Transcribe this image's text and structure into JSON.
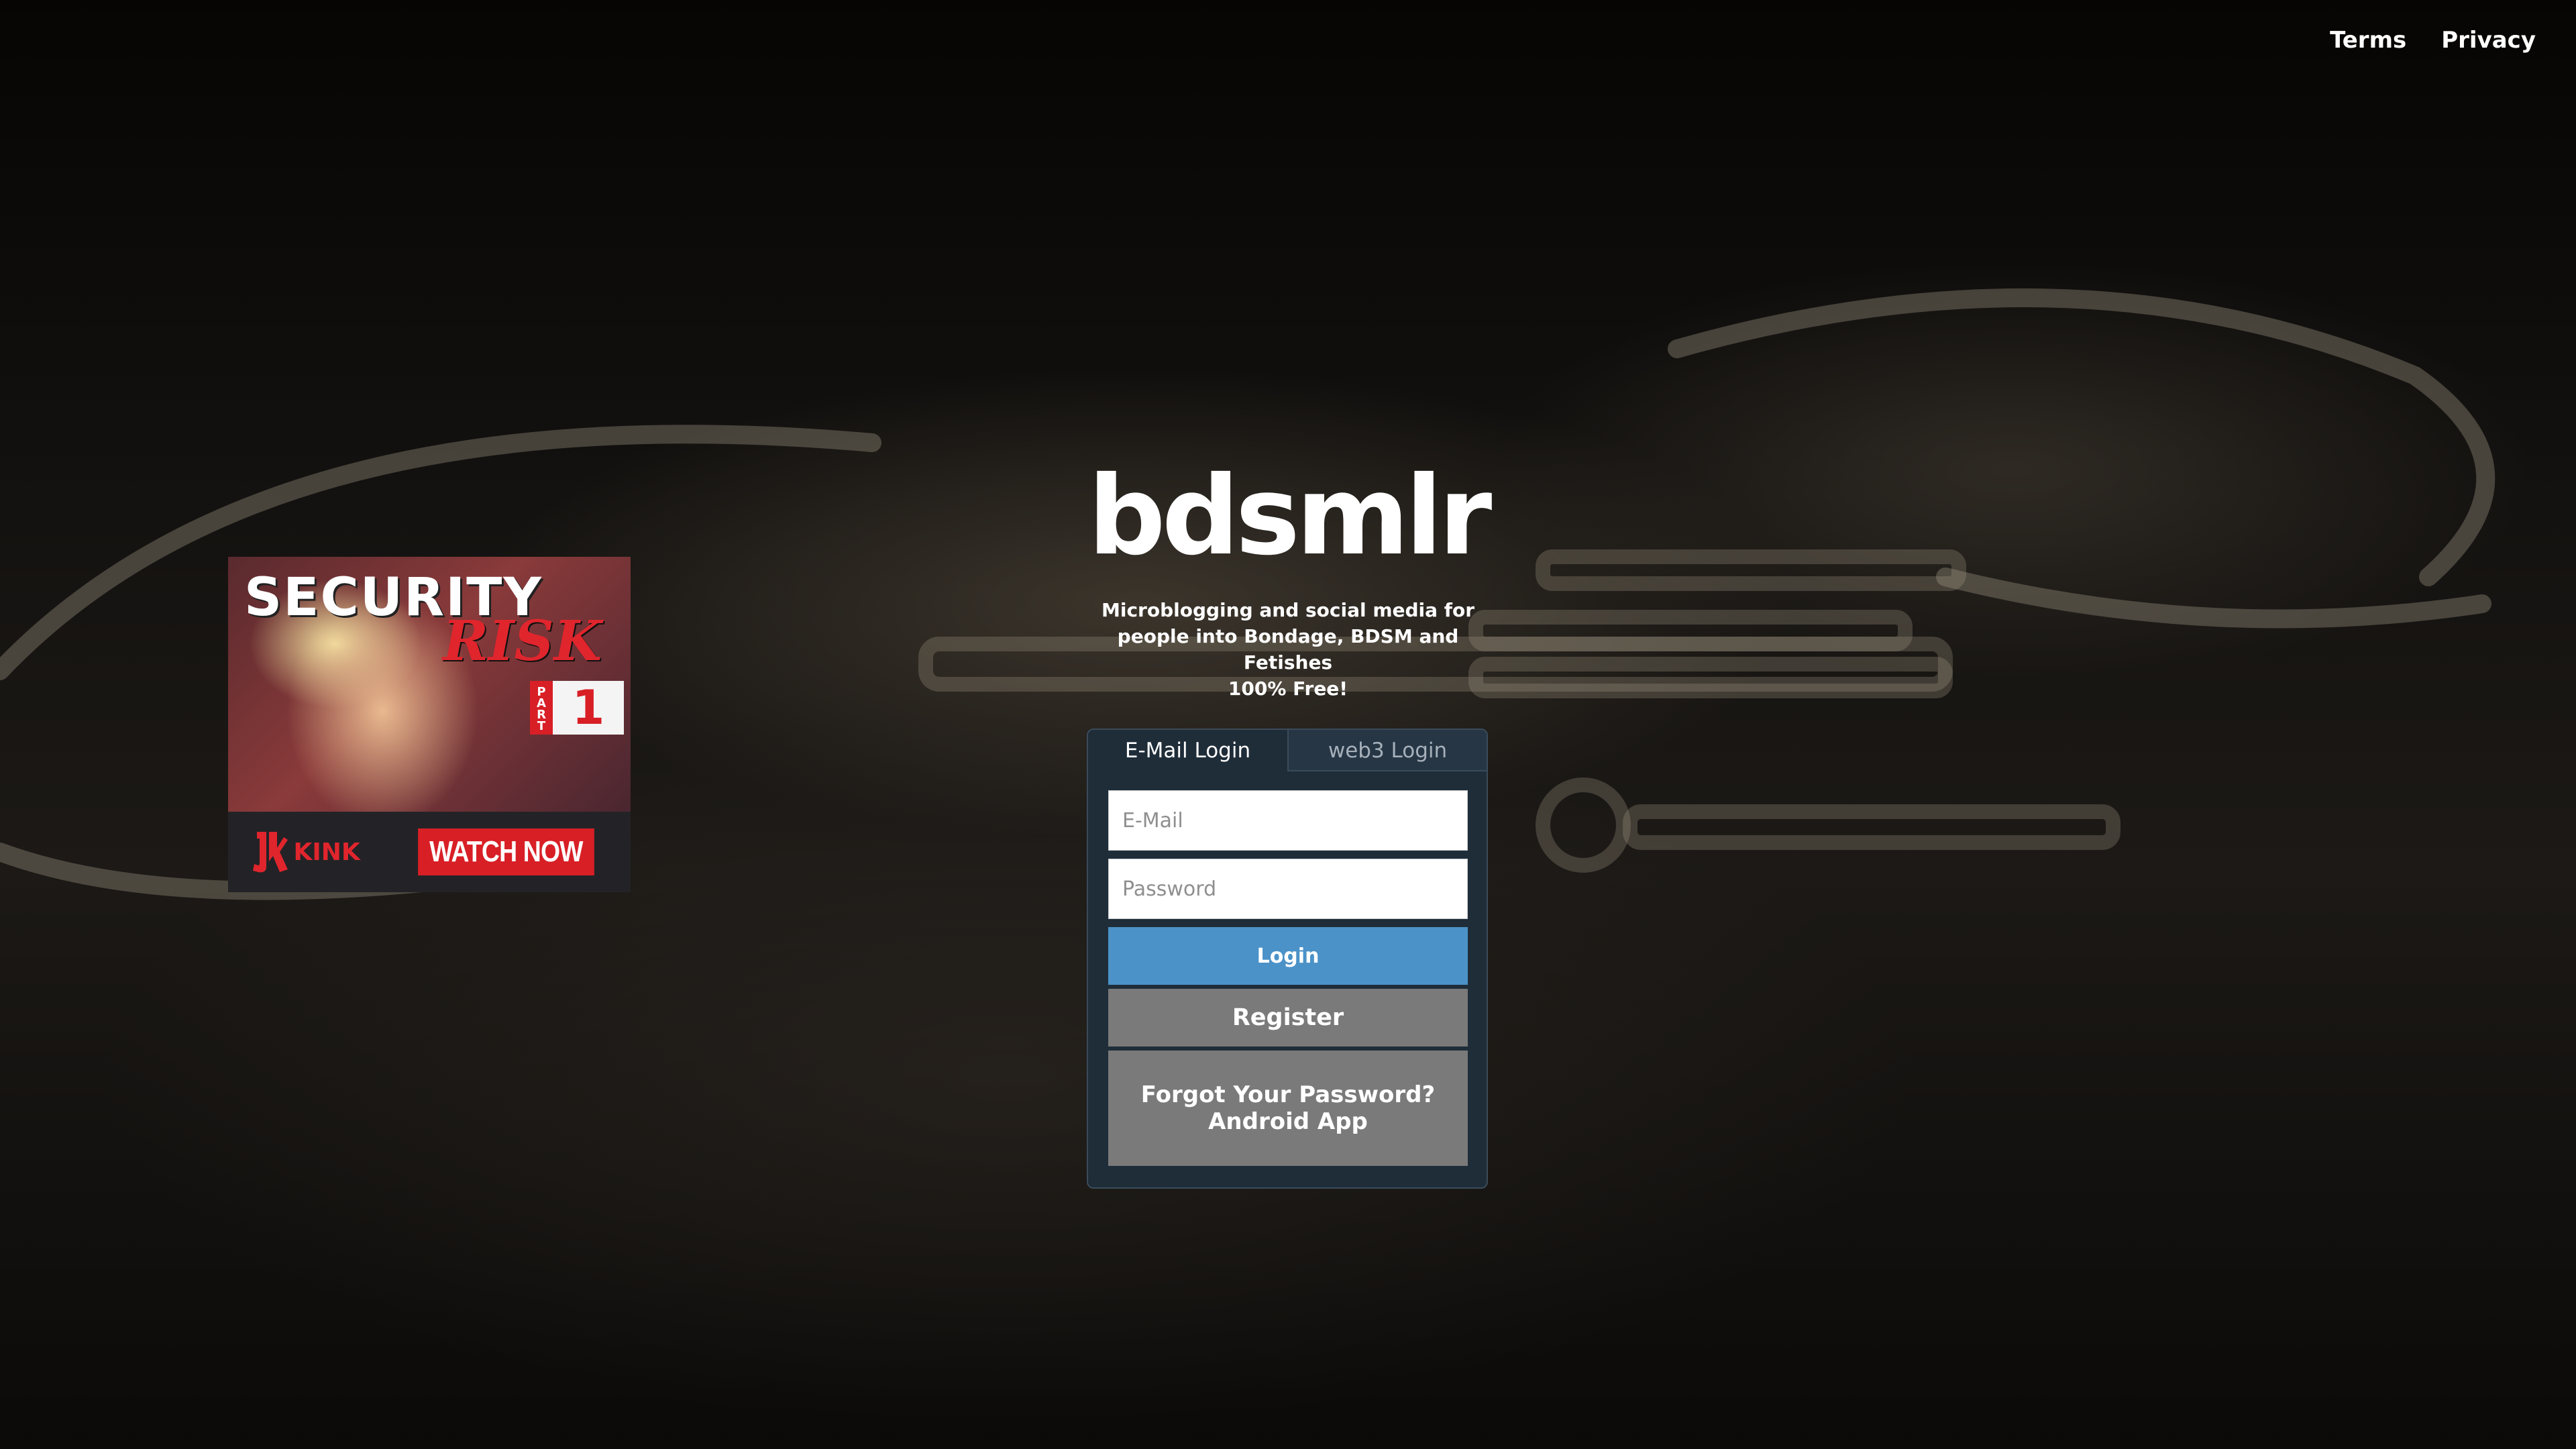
{
  "nav": {
    "terms_label": "Terms",
    "privacy_label": "Privacy"
  },
  "ad": {
    "title_line1": "SECURITY",
    "title_line2": "RISK",
    "part_label": "PART",
    "part_number": "1",
    "brand": "KINK",
    "cta": "WATCH NOW"
  },
  "brand": {
    "logo_text": "bdsmlr",
    "tagline_line1": "Microblogging and social media for people into Bondage, BDSM and Fetishes",
    "tagline_line2": "100% Free!"
  },
  "login": {
    "tabs": [
      {
        "label": "E-Mail Login",
        "active": true
      },
      {
        "label": "web3 Login",
        "active": false
      }
    ],
    "email_placeholder": "E-Mail",
    "email_value": "",
    "password_placeholder": "Password",
    "password_value": "",
    "login_label": "Login",
    "register_label": "Register",
    "forgot_label": "Forgot Your Password?",
    "android_label": "Android App"
  },
  "colors": {
    "panel_bg": "#1f2d39",
    "login_button": "#4b92c8",
    "secondary_button": "#7a7a7a",
    "ad_accent": "#d81f26"
  },
  "icons": {
    "kink_logo": "kink-logo-icon"
  }
}
